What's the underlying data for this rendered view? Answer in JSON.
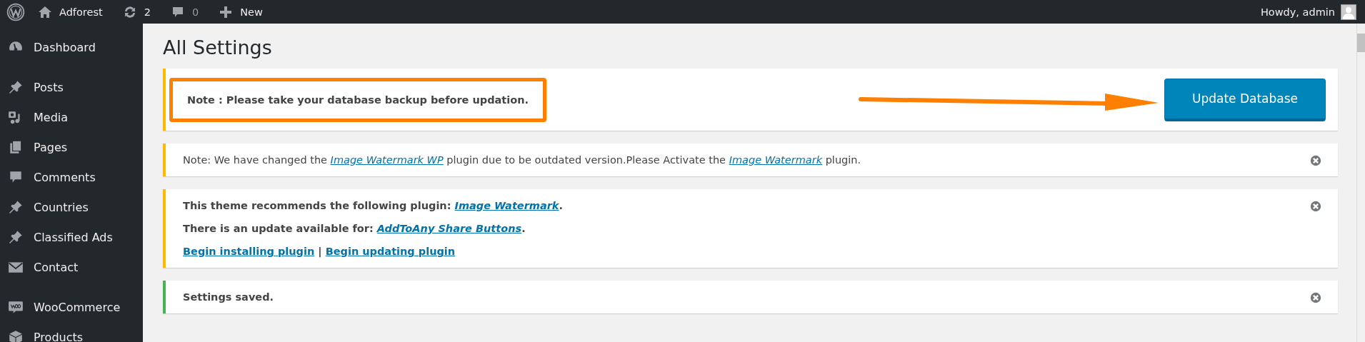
{
  "admin_bar": {
    "site_name": "Adforest",
    "updates_count": "2",
    "comments_count": "0",
    "new_label": "New",
    "greeting": "Howdy, admin"
  },
  "sidebar": {
    "groups": [
      [
        {
          "label": "Dashboard",
          "kind": "gauge",
          "selected": false
        }
      ],
      [
        {
          "label": "Posts",
          "kind": "pin",
          "selected": false
        },
        {
          "label": "Media",
          "kind": "media",
          "selected": false
        },
        {
          "label": "Pages",
          "kind": "pages",
          "selected": false
        },
        {
          "label": "Comments",
          "kind": "comment",
          "selected": false
        },
        {
          "label": "Countries",
          "kind": "pin",
          "selected": false
        },
        {
          "label": "Classified Ads",
          "kind": "pin",
          "selected": false
        },
        {
          "label": "Contact",
          "kind": "envelope",
          "selected": false
        }
      ],
      [
        {
          "label": "WooCommerce",
          "kind": "woo",
          "selected": false
        },
        {
          "label": "Products",
          "kind": "box",
          "selected": false
        }
      ]
    ]
  },
  "page": {
    "title": "All Settings"
  },
  "notices": [
    {
      "kind": "action",
      "color": "#ffb900",
      "bold": true,
      "highlighted": true,
      "arrow": true,
      "button": "Update Database",
      "lines": [
        [
          {
            "text": "Note : Please take your database backup before updation."
          }
        ]
      ]
    },
    {
      "kind": "message",
      "color": "#ffb900",
      "bold": false,
      "dismissible": true,
      "lines": [
        [
          {
            "text": "Note: We have changed the "
          },
          {
            "link": "Image Watermark WP",
            "italic": true
          },
          {
            "text": " plugin due to be outdated version.Please Activate the "
          },
          {
            "link": "Image Watermark",
            "italic": true
          },
          {
            "text": " plugin."
          }
        ]
      ]
    },
    {
      "kind": "message",
      "color": "#ffb900",
      "bold": true,
      "dismissible": true,
      "lines": [
        [
          {
            "text": "This theme recommends the following plugin: "
          },
          {
            "link": "Image Watermark",
            "italic": true
          },
          {
            "text": "."
          }
        ],
        [
          {
            "text": "There is an update available for: "
          },
          {
            "link": "AddToAny Share Buttons",
            "italic": true
          },
          {
            "text": "."
          }
        ],
        [
          {
            "link": "Begin installing plugin",
            "italic": false
          },
          {
            "text": " | "
          },
          {
            "link": "Begin updating plugin",
            "italic": false
          }
        ]
      ]
    },
    {
      "kind": "message",
      "color": "#46b450",
      "bold": true,
      "dismissible": true,
      "lines": [
        [
          {
            "text": "Settings saved."
          }
        ]
      ]
    }
  ]
}
